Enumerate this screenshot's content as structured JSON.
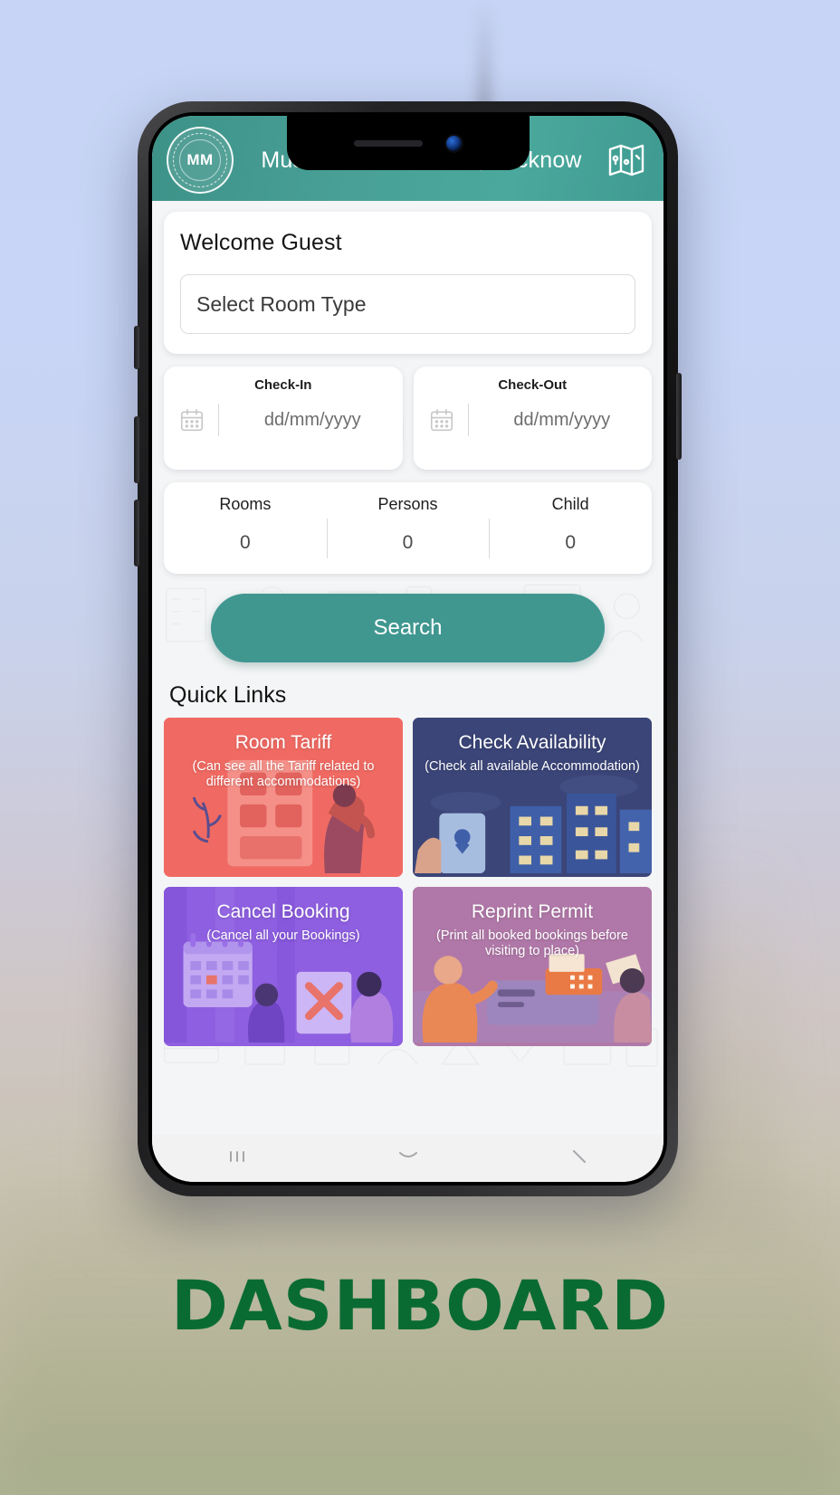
{
  "caption": "DASHBOARD",
  "colors": {
    "header_teal": "#44a095",
    "search_teal": "#3f9790",
    "caption_green": "#0a6b32",
    "card_room_tariff": "#f06a63",
    "card_check_availability": "#3b4578",
    "card_cancel_booking": "#8e5fe0",
    "card_reprint_permit": "#b078a8",
    "page_bg": "#f4f5f6"
  },
  "header": {
    "logo_text": "MM",
    "logo_icon": "seal-logo-icon",
    "title": "Muslim Musafirkhana, Lucknow",
    "map_icon": "map-icon"
  },
  "welcome": {
    "title": "Welcome Guest",
    "room_type_placeholder": "Select Room Type",
    "room_type_value": ""
  },
  "dates": [
    {
      "label": "Check-In",
      "placeholder": "dd/mm/yyyy",
      "value": "",
      "icon": "calendar-icon"
    },
    {
      "label": "Check-Out",
      "placeholder": "dd/mm/yyyy",
      "value": "",
      "icon": "calendar-icon"
    }
  ],
  "counts": [
    {
      "label": "Rooms",
      "value": "0"
    },
    {
      "label": "Persons",
      "value": "0"
    },
    {
      "label": "Child",
      "value": "0"
    }
  ],
  "search": {
    "label": "Search"
  },
  "quick_links": {
    "title": "Quick Links",
    "cards": [
      {
        "title": "Room Tariff",
        "subtitle": "(Can see all the Tariff related to different accommodations)",
        "color": "#f06a63"
      },
      {
        "title": "Check Availability",
        "subtitle": "(Check all available Accommodation)",
        "color": "#3b4578"
      },
      {
        "title": "Cancel Booking",
        "subtitle": "(Cancel all your Bookings)",
        "color": "#8e5fe0"
      },
      {
        "title": "Reprint Permit",
        "subtitle": "(Print all booked bookings before visiting to place)",
        "color": "#b078a8"
      }
    ]
  },
  "nav_bar": {
    "recents_icon": "recents-icon",
    "home_icon": "home-icon",
    "back_icon": "back-icon"
  }
}
